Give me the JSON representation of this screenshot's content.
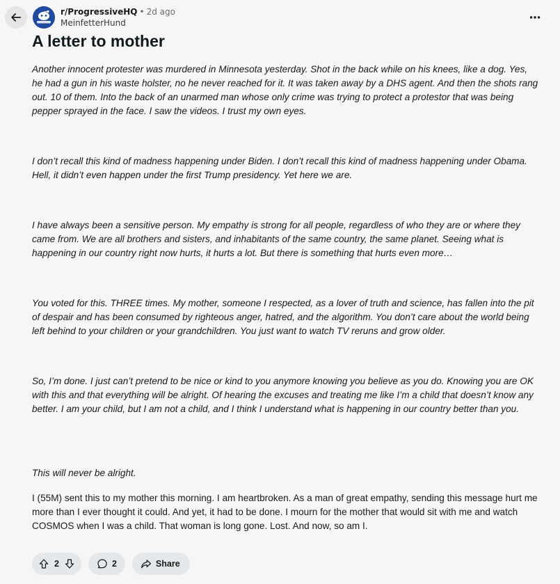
{
  "header": {
    "back_icon": "arrow-left-icon",
    "avatar_icon": "subreddit-avatar-icon",
    "subreddit": "r/ProgressiveHQ",
    "separator": "•",
    "time_ago": "2d ago",
    "author": "MeinfetterHund",
    "more_icon": "more-horizontal-icon"
  },
  "post": {
    "title": "A letter to mother",
    "paragraphs": [
      "Another innocent protester was murdered in Minnesota yesterday. Shot in the back while on his knees, like a dog. Yes, he had a gun in his waste holster, no he never reached for it. It was taken away by a DHS agent. And then the shots rang out. 10 of them. Into the back of an unarmed man whose only crime was trying to protect a protestor that was being pepper sprayed in the face. I saw the videos. I trust my own eyes.",
      "I don’t recall this kind of madness happening under Biden. I don’t recall this kind of madness happening under Obama. Hell, it didn’t even happen under the first Trump presidency. Yet here we are.",
      "I have always been a sensitive person. My empathy is strong for all people, regardless of who they are or where they came from. We are all brothers and sisters, and inhabitants of the same country, the same planet. Seeing what is happening in our country right now hurts, it hurts a lot. But there is something that hurts even more…",
      "You voted for this. THREE times. My mother, someone I respected, as a lover of truth and science, has fallen into the pit of despair and has been consumed by righteous anger, hatred, and the algorithm. You don’t care about the world being left behind to your children or your grandchildren. You just want to watch TV reruns and grow older.",
      "So, I’m done. I just can’t pretend to be nice or kind to you anymore knowing you believe as you do. Knowing you are OK with this and that everything will be alright. Of hearing the excuses and treating me like I’m a child that doesn’t know any better. I am your child, but I am not a child, and I think I understand what is happening in our country better than you.",
      "This will never be alright.",
      "I (55M) sent this to my mother this morning. I am heartbroken. As a man of great empathy, sending this message hurt me more than I ever thought it could. And yet, it had to be done. I mourn for the mother that would sit with me and watch COSMOS when I was a child. That woman is long gone. Lost. And now, so am I."
    ]
  },
  "actions": {
    "upvote_icon": "upvote-arrow-icon",
    "vote_count": "2",
    "downvote_icon": "downvote-arrow-icon",
    "comment_icon": "comment-bubble-icon",
    "comment_count": "2",
    "share_icon": "share-arrow-icon",
    "share_label": "Share"
  },
  "colors": {
    "background": "#f6f6f6",
    "pill_background": "#e5e8ea",
    "avatar_blue": "#1f4aa0"
  }
}
